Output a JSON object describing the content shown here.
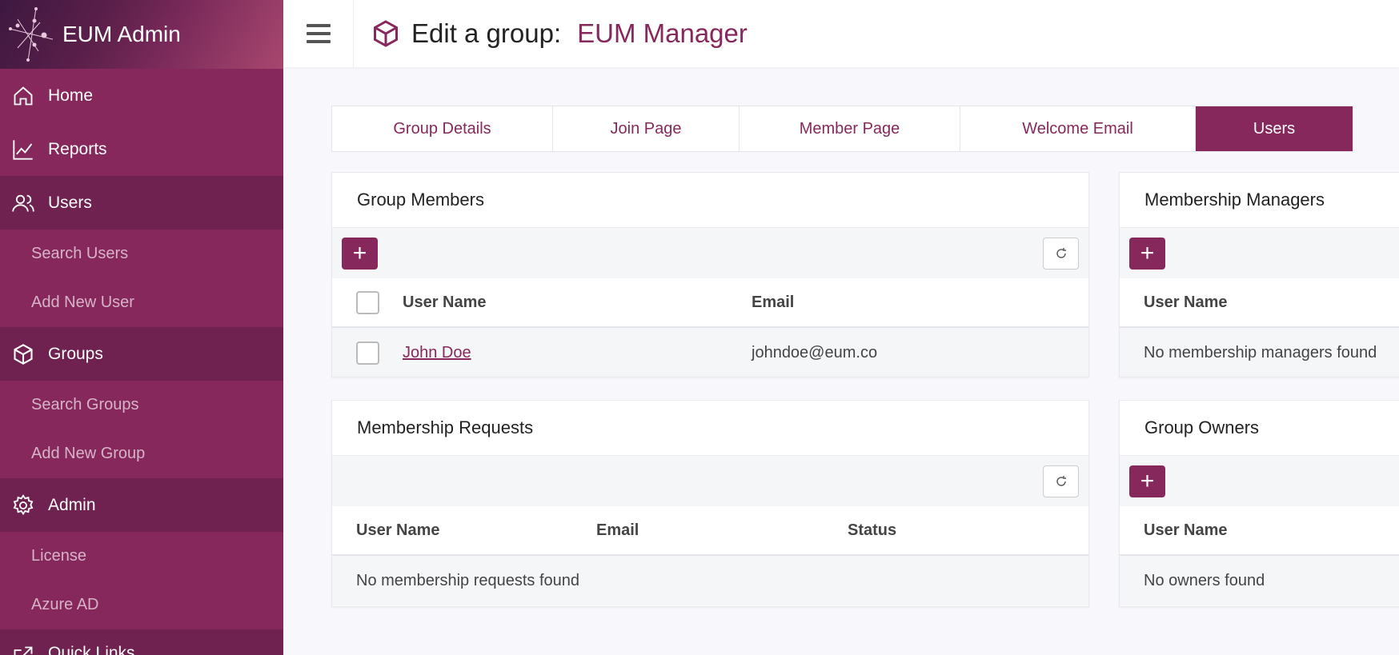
{
  "app": {
    "title": "EUM Admin"
  },
  "sidebar": {
    "items": [
      {
        "label": "Home",
        "icon": "home-icon"
      },
      {
        "label": "Reports",
        "icon": "chart-line-icon"
      },
      {
        "label": "Users",
        "icon": "users-icon"
      },
      {
        "label": "Search Users"
      },
      {
        "label": "Add New User"
      },
      {
        "label": "Groups",
        "icon": "cube-icon"
      },
      {
        "label": "Search Groups"
      },
      {
        "label": "Add New Group"
      },
      {
        "label": "Admin",
        "icon": "gear-icon"
      },
      {
        "label": "License"
      },
      {
        "label": "Azure AD"
      },
      {
        "label": "Quick Links",
        "icon": "external-link-icon"
      }
    ]
  },
  "header": {
    "title_prefix": "Edit a group:",
    "group_name": "EUM Manager"
  },
  "tabs": [
    "Group Details",
    "Join Page",
    "Member Page",
    "Welcome Email",
    "Users"
  ],
  "group_members": {
    "title": "Group Members",
    "columns": [
      "User Name",
      "Email"
    ],
    "rows": [
      {
        "name": "John Doe",
        "email": "johndoe@eum.co"
      }
    ]
  },
  "membership_requests": {
    "title": "Membership Requests",
    "columns": [
      "User Name",
      "Email",
      "Status"
    ],
    "empty": "No membership requests found"
  },
  "membership_managers": {
    "title": "Membership Managers",
    "columns": [
      "User Name"
    ],
    "empty": "No membership managers found"
  },
  "group_owners": {
    "title": "Group Owners",
    "columns": [
      "User Name"
    ],
    "empty": "No owners found"
  },
  "colors": {
    "accent": "#87285c",
    "sidebar_dark": "#6f2150"
  }
}
